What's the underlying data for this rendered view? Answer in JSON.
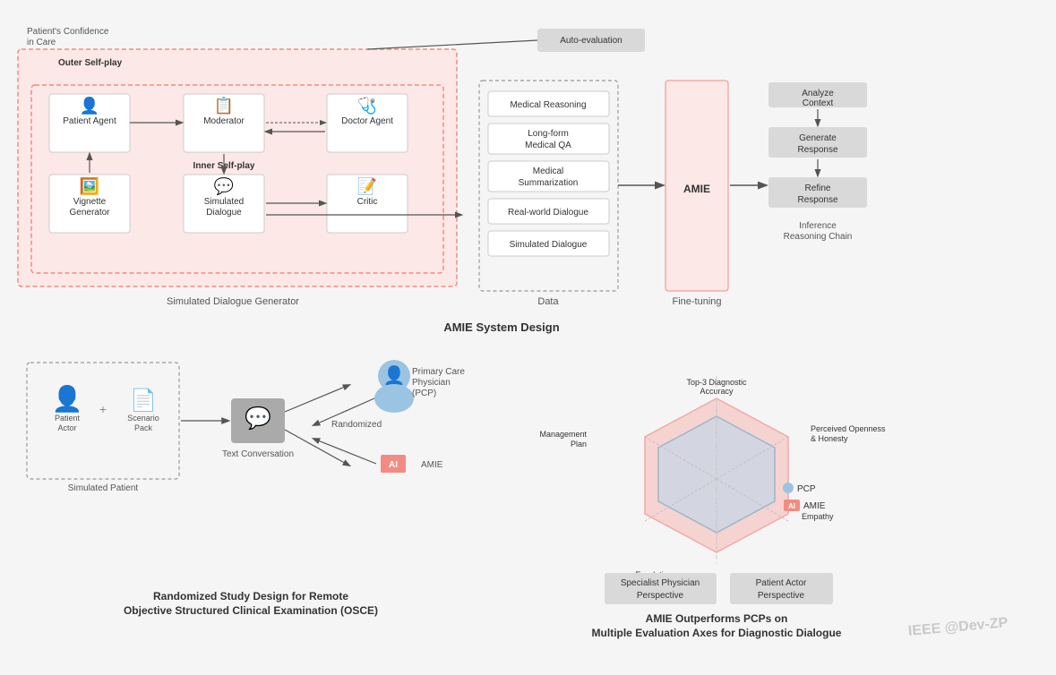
{
  "title": "AMIE System Design",
  "top": {
    "outer_label_confidence": "Patient's Confidence\nin Care",
    "outer_label_selfplay": "Outer Self-play",
    "auto_eval": "Auto-evaluation",
    "patient_agent": "Patient Agent",
    "moderator": "Moderator",
    "doctor_agent": "Doctor Agent",
    "vignette_generator": "Vignette\nGenerator",
    "simulated_dialogue": "Simulated\nDialogue",
    "critic": "Critic",
    "inner_selfplay": "Inner Self-play",
    "data_items": [
      "Medical Reasoning",
      "Long-form\nMedical QA",
      "Medical\nSummarization",
      "Real-world Dialogue",
      "Simulated Dialogue"
    ],
    "data_label": "Data",
    "amie_label": "AMIE",
    "fine_tuning_label": "Fine-tuning",
    "analyze_context": "Analyze\nContext",
    "generate_response": "Generate\nResponse",
    "refine_response": "Refine\nResponse",
    "inference_label": "Inference\nReasoning Chain",
    "simulated_dialogue_label": "Simulated Dialogue Generator"
  },
  "bottom_left": {
    "patient_actor": "Patient\nActor",
    "scenario_pack": "Scenario\nPack",
    "simulated_patient": "Simulated Patient",
    "randomized": "Randomized",
    "text_conversation": "Text Conversation",
    "pcp_label": "Primary Care\nPhysician\n(PCP)",
    "amie_label": "AMIE",
    "ai_tag": "AI",
    "title": "Randomized Study Design for Remote\nObjective Structured Clinical Examination (OSCE)"
  },
  "bottom_right": {
    "axes": [
      "Top-3 Diagnostic\nAccuracy",
      "Perceived Openness\n& Honesty",
      "Empathy",
      "Escalation\nRecommendation",
      "Management\nPlan"
    ],
    "legend_pcp": "PCP",
    "legend_amie": "AMIE",
    "eval_boxes": [
      "Specialist Physician\nPerspective",
      "Patient Actor\nPerspective"
    ],
    "title": "AMIE Outperforms PCPs on\nMultiple Evaluation Axes for Diagnostic Dialogue"
  },
  "watermark": "IEEE @Dev-ZP"
}
